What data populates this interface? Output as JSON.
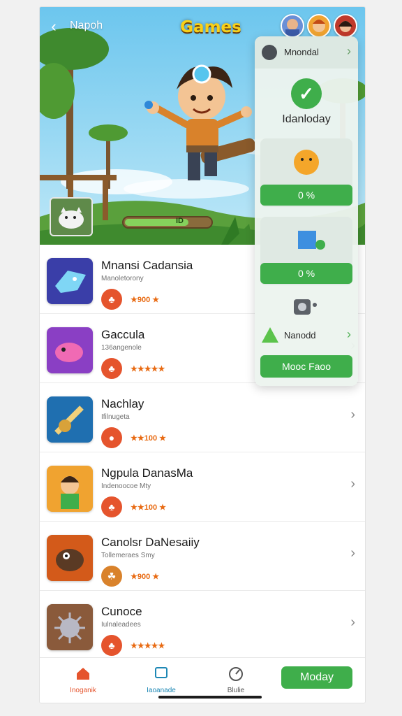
{
  "header": {
    "back_icon": "chevron-left-icon",
    "user_name": "Napoh",
    "title": "Games",
    "avatars": [
      "avatar-1",
      "avatar-2",
      "avatar-3"
    ],
    "progress_label": "ID",
    "progress_fraction": 0.72
  },
  "games": [
    {
      "title": "Mnansi Cadansia",
      "subtitle": "Manoletorоny",
      "rating": "★900 ★",
      "icon": "crystal-fish-icon"
    },
    {
      "title": "Gaccula",
      "subtitle": "136angenole",
      "rating": "★★★★★",
      "icon": "pink-creature-icon"
    },
    {
      "title": "Nachlay",
      "subtitle": "Ifilnugeta",
      "rating": "★★100 ★",
      "icon": "sword-icon"
    },
    {
      "title": "Ngpula DanasMa",
      "subtitle": "Indenoocoe Mty",
      "rating": "★★100 ★",
      "icon": "hero-portrait-icon"
    },
    {
      "title": "Canolsr DaNesaiiy",
      "subtitle": "Tollemeraes Smy",
      "rating": "★900 ★",
      "icon": "mole-creature-icon"
    },
    {
      "title": "Cunoce",
      "subtitle": "Iulnaleadees",
      "rating": "★★★★★",
      "icon": "spiky-ball-icon"
    }
  ],
  "panel": {
    "header_label": "Mnondal",
    "check_label": "Idanloday",
    "card1_value": "0 %",
    "card2_value": "0 %",
    "item_label": "Nanodd",
    "button_label": "Mooc Faoo"
  },
  "nav": {
    "items": [
      {
        "label": "Inoganik",
        "icon": "home-icon",
        "color": "#e5542d"
      },
      {
        "label": "Iaoanade",
        "icon": "device-icon",
        "color": "#1e88b5"
      },
      {
        "label": "Blulie",
        "icon": "gauge-icon",
        "color": "#555555"
      }
    ],
    "cta_label": "Moday"
  },
  "colors": {
    "accent": "#3fae4b",
    "badge": "#e5542d",
    "rating": "#e86a12"
  }
}
